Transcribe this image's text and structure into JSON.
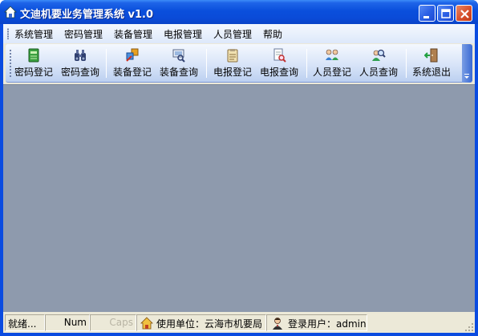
{
  "window": {
    "title": "文迪机要业务管理系统 v1.0"
  },
  "menubar": {
    "items": [
      "系统管理",
      "密码管理",
      "装备管理",
      "电报管理",
      "人员管理",
      "帮助"
    ]
  },
  "toolbar": {
    "buttons": [
      {
        "label": "密码登记",
        "icon": "green-ledger-icon"
      },
      {
        "label": "密码查询",
        "icon": "binoculars-icon"
      },
      {
        "label": "装备登记",
        "icon": "equipment-register-icon"
      },
      {
        "label": "装备查询",
        "icon": "equipment-search-icon"
      },
      {
        "label": "电报登记",
        "icon": "clipboard-icon"
      },
      {
        "label": "电报查询",
        "icon": "document-search-icon"
      },
      {
        "label": "人员登记",
        "icon": "users-icon"
      },
      {
        "label": "人员查询",
        "icon": "user-search-icon"
      },
      {
        "label": "系统退出",
        "icon": "exit-door-icon"
      }
    ]
  },
  "statusbar": {
    "ready": "就绪...",
    "num": "Num",
    "caps": "Caps",
    "unit": "使用单位：云海市机要局",
    "user": "登录用户：admin"
  },
  "colors": {
    "titlebar": "#0a4bd8",
    "workspace": "#8e9aad",
    "face": "#ece9d8"
  }
}
